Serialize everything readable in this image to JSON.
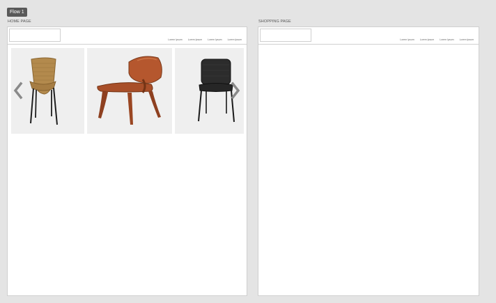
{
  "flow": {
    "label": "Flow 1"
  },
  "artboards": [
    {
      "label": "HOME PAGE",
      "nav": [
        "Lorem Ipsum",
        "Lorem Ipsum",
        "Lorem Ipsum",
        "Lorem Ipsum"
      ],
      "carousel": {
        "cards": [
          {
            "name": "wicker-chair-image"
          },
          {
            "name": "wood-lounge-chair-image"
          },
          {
            "name": "black-upholstered-chair-image"
          }
        ],
        "icons": {
          "prev": "chevron-left-icon",
          "next": "chevron-right-icon"
        }
      }
    },
    {
      "label": "SHOPPING PAGE",
      "nav": [
        "Lorem Ipsum",
        "Lorem Ipsum",
        "Lorem Ipsum",
        "Lorem Ipsum"
      ]
    }
  ],
  "colors": {
    "canvas": "#e4e4e4",
    "flow_tag": "#595959",
    "border": "#cfcfcf",
    "card_bg": "#efefef",
    "arrow": "#8a8a8a"
  }
}
